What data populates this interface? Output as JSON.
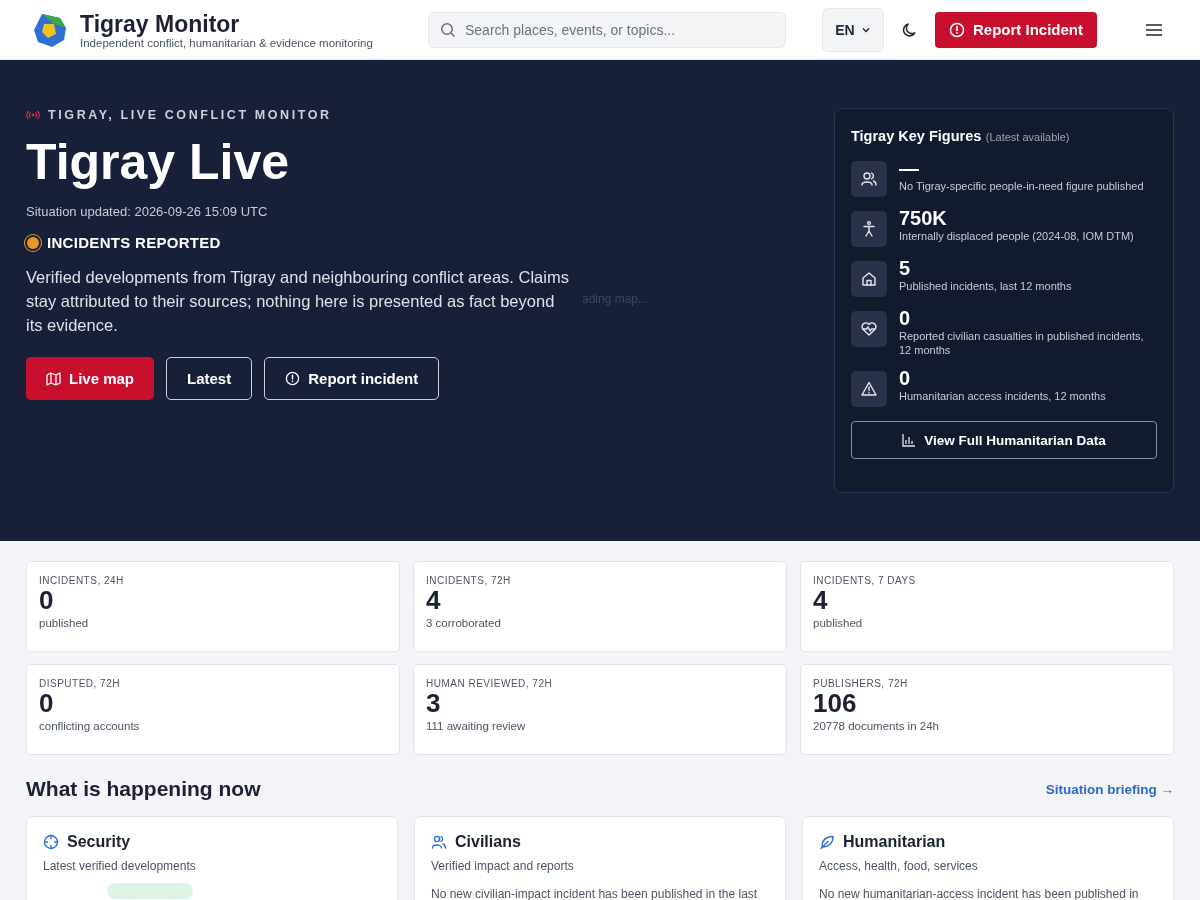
{
  "header": {
    "brand": "Tigray Monitor",
    "tagline": "Independent conflict, humanitarian & evidence monitoring",
    "search": {
      "placeholder": "Search places, events, or topics..."
    },
    "language": "EN",
    "report_button": "Report Incident"
  },
  "hero": {
    "eyebrow": "TIGRAY, LIVE CONFLICT MONITOR",
    "title": "Tigray Live",
    "updated": "Situation updated: 2026-09-26 15:09 UTC",
    "status": {
      "label": "INCIDENTS REPORTED",
      "color": "#e8962a"
    },
    "description": "Verified developments from Tigray and neighbouring conflict areas. Claims stay attributed to their sources; nothing here is presented as fact beyond its evidence.",
    "map_loading": "ading map...",
    "buttons": [
      {
        "kind": "primary",
        "label": "Live map"
      },
      {
        "kind": "outline",
        "label": "Latest"
      },
      {
        "kind": "outline",
        "label": "Report incident"
      }
    ]
  },
  "key_figures": {
    "title": "Tigray Key Figures",
    "note": "(Latest available)",
    "items": [
      {
        "value": "—",
        "label": "No Tigray-specific people-in-need figure published"
      },
      {
        "value": "750K",
        "label": "Internally displaced people (2024-08, IOM DTM)"
      },
      {
        "value": "5",
        "label": "Published incidents, last 12 months"
      },
      {
        "value": "0",
        "label": "Reported civilian casualties in published incidents, 12 months"
      },
      {
        "value": "0",
        "label": "Humanitarian access incidents, 12 months"
      }
    ],
    "button": "View Full Humanitarian Data"
  },
  "stats": [
    {
      "label": "INCIDENTS, 24H",
      "value": "0",
      "note": "published"
    },
    {
      "label": "INCIDENTS, 72H",
      "value": "4",
      "note": "3 corroborated"
    },
    {
      "label": "INCIDENTS, 7 DAYS",
      "value": "4",
      "note": "published"
    },
    {
      "label": "DISPUTED, 72H",
      "value": "0",
      "note": "conflicting accounts"
    },
    {
      "label": "HUMAN REVIEWED, 72H",
      "value": "3",
      "note": "111 awaiting review"
    },
    {
      "label": "PUBLISHERS, 72H",
      "value": "106",
      "note": "20778 documents in 24h"
    }
  ],
  "happening": {
    "title": "What is happening now",
    "link": "Situation briefing →",
    "cards": [
      {
        "title": "Security",
        "subtitle": "Latest verified developments"
      },
      {
        "title": "Civilians",
        "subtitle": "Verified impact and reports",
        "body": "No new civilian-impact incident has been published in the last"
      },
      {
        "title": "Humanitarian",
        "subtitle": "Access, health, food, services",
        "body": "No new humanitarian-access incident has been published in"
      }
    ]
  }
}
